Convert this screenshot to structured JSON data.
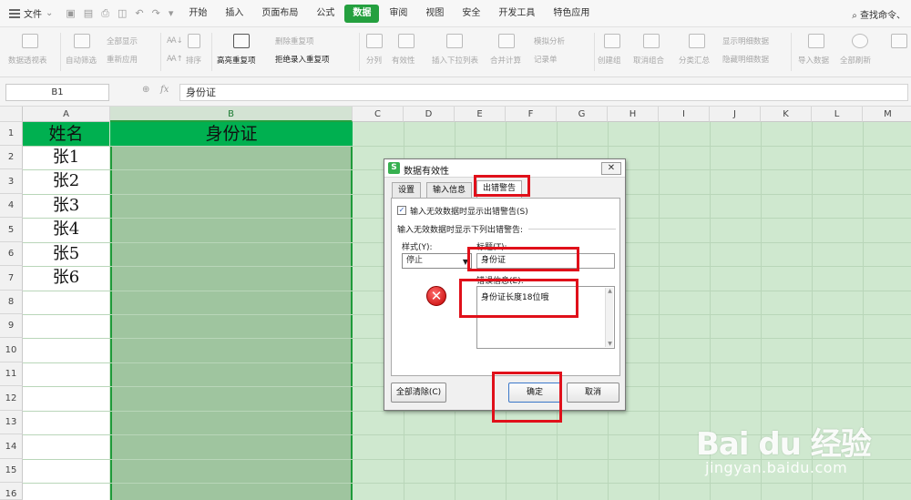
{
  "menu": {
    "file_label": "文件",
    "tabs": [
      "开始",
      "插入",
      "页面布局",
      "公式",
      "数据",
      "审阅",
      "视图",
      "安全",
      "开发工具",
      "特色应用"
    ],
    "active_tab": "数据",
    "search": "查找命令、"
  },
  "ribbon": {
    "pivot": "数据透视表",
    "autofilter": "自动筛选",
    "show_all": "全部显示",
    "reapply": "重新应用",
    "sort": "排序",
    "highlight_dup": "高亮重复项",
    "delete_dup": "删除重复项",
    "reject_dup": "拒绝录入重复项",
    "split": "分列",
    "validity": "有效性",
    "insert_dropdown": "插入下拉列表",
    "consolidate": "合并计算",
    "simulate": "模拟分析",
    "record": "记录单",
    "create_group": "创建组",
    "ungroup": "取消组合",
    "subtotal": "分类汇总",
    "show_detail": "显示明细数据",
    "hide_detail": "隐藏明细数据",
    "import": "导入数据",
    "refresh_all": "全部刷新"
  },
  "formula_bar": {
    "cell_ref": "B1",
    "formula": "身份证"
  },
  "sheet": {
    "columns": [
      "A",
      "B",
      "C",
      "D",
      "E",
      "F",
      "G",
      "H",
      "I",
      "J",
      "K",
      "L",
      "M"
    ],
    "rows": [
      "1",
      "2",
      "3",
      "4",
      "5",
      "6",
      "7",
      "8",
      "9",
      "10",
      "11",
      "12",
      "13",
      "14",
      "15",
      "16"
    ],
    "header_a": "姓名",
    "header_b": "身份证",
    "names": [
      "张1",
      "张2",
      "张3",
      "张4",
      "张5",
      "张6"
    ]
  },
  "dialog": {
    "title": "数据有效性",
    "logo": "S",
    "close": "✕",
    "tabs": [
      "设置",
      "输入信息",
      "出错警告"
    ],
    "show_error_checkbox": "输入无效数据时显示出错警告(S)",
    "show_error_checked": true,
    "section_label": "输入无效数据时显示下列出错警告:",
    "style_label": "样式(Y):",
    "style_value": "停止",
    "title_label": "标题(T):",
    "title_value": "身份证",
    "error_label": "错误信息(E):",
    "error_value": "身份证长度18位哦",
    "clear_button": "全部清除(C)",
    "ok_button": "确定",
    "cancel_button": "取消"
  },
  "watermark": {
    "logo": "Bai du 经验",
    "url": "jingyan.baidu.com"
  },
  "colors": {
    "accent": "#24a03f",
    "header_fill": "#00b050",
    "annotation": "#e0101a"
  }
}
